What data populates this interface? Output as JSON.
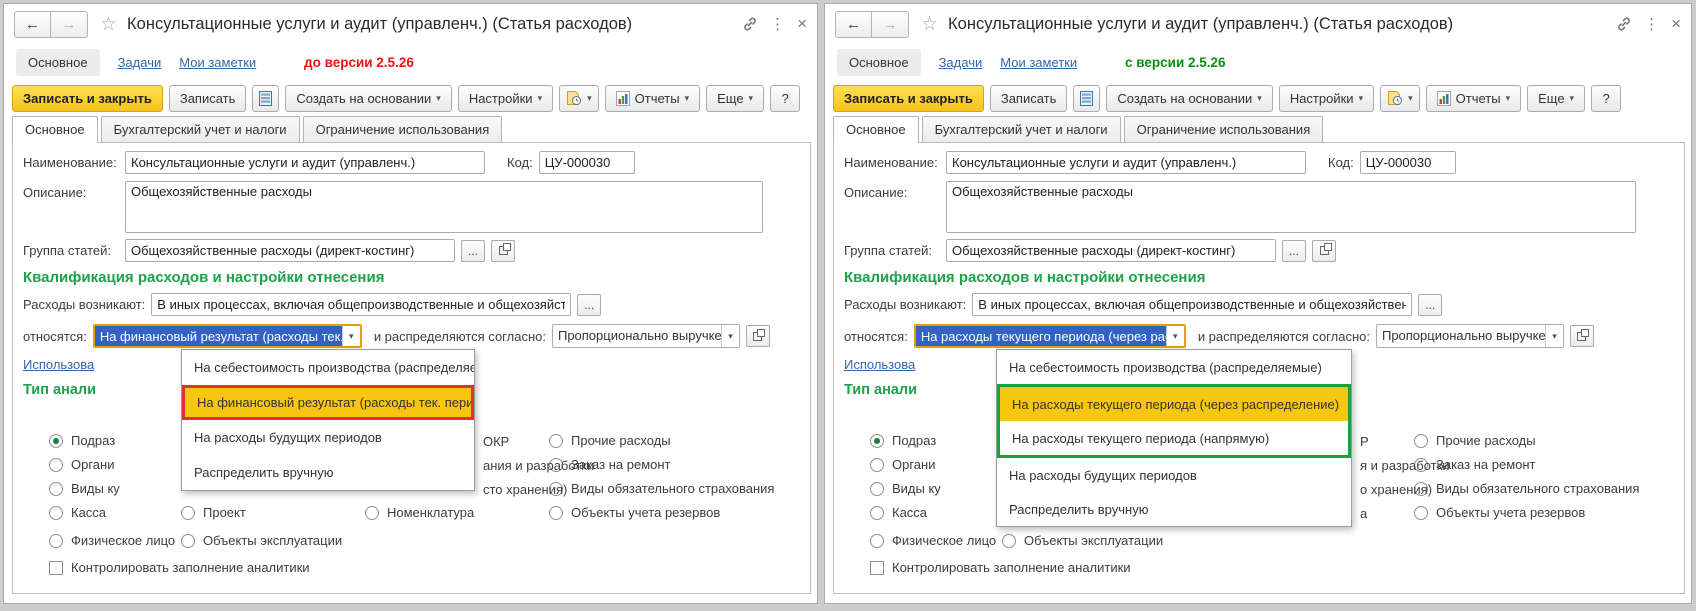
{
  "colors": {
    "title_underline": "#21a038",
    "before_frame": "#e0312e",
    "after_frame": "#1e9e3e",
    "dropdown_highlight": "#f6c611",
    "selection_blue": "#3163c5",
    "attention_border": "#dfa202",
    "section_green": "#1fa24a"
  },
  "windows": [
    {
      "title": "Консультационные услуги и аудит (управленч.)",
      "title_suffix": "(Статья расходов)",
      "version_note": "до версии 2.5.26",
      "nav": {
        "active": "Основное",
        "links": [
          "Задачи",
          "Мои заметки"
        ]
      },
      "toolbar": {
        "save_close": "Записать и закрыть",
        "save": "Записать",
        "create_based": "Создать на основании",
        "settings": "Настройки",
        "reports": "Отчеты",
        "more": "Еще",
        "help": "?"
      },
      "tabs": [
        "Основное",
        "Бухгалтерский учет и налоги",
        "Ограничение использования"
      ],
      "fields": {
        "name_label": "Наименование:",
        "name_value": "Консультационные услуги и аудит (управленч.)",
        "code_label": "Код:",
        "code_value": "ЦУ-000030",
        "desc_label": "Описание:",
        "desc_value": "Общехозяйственные расходы",
        "group_label": "Группа статей:",
        "group_value": "Общехозяйственные расходы (директ-костинг)",
        "section_header": "Квалификация расходов и настройки отнесения",
        "occur_label": "Расходы возникают:",
        "occur_value": "В иных процессах, включая общепроизводственные и общехозяйственные",
        "relate_label": "относятся:",
        "relate_value": "На финансовый результат (расходы тек. пе",
        "distribute_label": "и распределяются согласно:",
        "distribute_value": "Пропорционально выручке",
        "usage_link_fragment": "Использова",
        "analytics_header_fragment": "Тип анали",
        "ellipsis": "..."
      },
      "dropdown": {
        "items": [
          {
            "label": "На себестоимость производства (распределяемые)"
          },
          {
            "label": "На финансовый результат (расходы тек. периода)",
            "highlighted": true,
            "frame": "red"
          },
          {
            "label": "На расходы будущих периодов"
          },
          {
            "label": "Распределить вручную"
          }
        ]
      },
      "analytics": {
        "items": [
          {
            "label": "Подраз",
            "selected": true
          },
          {
            "label": "Органи"
          },
          {
            "label": "Виды ку"
          },
          {
            "label": "Касса"
          },
          {
            "label": "Физическое лицо"
          },
          {
            "label": "Проект"
          },
          {
            "label": "Объекты эксплуатации"
          },
          {
            "label": "Номенклатура"
          },
          {
            "label": "Прочие расходы"
          },
          {
            "label": "Заказ на ремонт"
          },
          {
            "label": "Виды обязательного страхования"
          },
          {
            "label": "Объекты учета резервов"
          }
        ],
        "fragments": [
          {
            "label": "ОКР"
          },
          {
            "label": "ания и разработки"
          },
          {
            "label": "сто хранения)"
          }
        ],
        "checkbox_label": "Контролировать заполнение аналитики"
      }
    },
    {
      "title": "Консультационные услуги и аудит (управленч.)",
      "title_suffix": "(Статья расходов)",
      "version_note": "с версии 2.5.26",
      "nav": {
        "active": "Основное",
        "links": [
          "Задачи",
          "Мои заметки"
        ]
      },
      "toolbar": {
        "save_close": "Записать и закрыть",
        "save": "Записать",
        "create_based": "Создать на основании",
        "settings": "Настройки",
        "reports": "Отчеты",
        "more": "Еще",
        "help": "?"
      },
      "tabs": [
        "Основное",
        "Бухгалтерский учет и налоги",
        "Ограничение использования"
      ],
      "fields": {
        "name_label": "Наименование:",
        "name_value": "Консультационные услуги и аудит (управленч.)",
        "code_label": "Код:",
        "code_value": "ЦУ-000030",
        "desc_label": "Описание:",
        "desc_value": "Общехозяйственные расходы",
        "group_label": "Группа статей:",
        "group_value": "Общехозяйственные расходы (директ-костинг)",
        "section_header": "Квалификация расходов и настройки отнесения",
        "occur_label": "Расходы возникают:",
        "occur_value": "В иных процессах, включая общепроизводственные и общехозяйственные",
        "relate_label": "относятся:",
        "relate_value": "На расходы текущего периода (через расп",
        "distribute_label": "и распределяются согласно:",
        "distribute_value": "Пропорционально выручке",
        "usage_link_fragment": "Использова",
        "analytics_header_fragment": "Тип анали",
        "ellipsis": "..."
      },
      "dropdown": {
        "items": [
          {
            "label": "На себестоимость производства (распределяемые)"
          },
          {
            "label": "На расходы текущего периода (через распределение)",
            "highlighted": true,
            "frame": "green"
          },
          {
            "label": "На расходы текущего периода (напрямую)",
            "frame": "green"
          },
          {
            "label": "На расходы будущих периодов"
          },
          {
            "label": "Распределить вручную"
          }
        ]
      },
      "analytics": {
        "items": [
          {
            "label": "Подраз",
            "selected": true
          },
          {
            "label": "Органи"
          },
          {
            "label": "Виды ку"
          },
          {
            "label": "Касса"
          },
          {
            "label": "Физическое лицо"
          },
          {
            "label": "Объекты эксплуатации"
          },
          {
            "label": "Прочие расходы"
          },
          {
            "label": "Заказ на ремонт"
          },
          {
            "label": "Виды обязательного страхования"
          },
          {
            "label": "Объекты учета резервов"
          }
        ],
        "fragments": [
          {
            "label": "Р"
          },
          {
            "label": "я и разработки"
          },
          {
            "label": "о хранения)"
          },
          {
            "label": "а"
          }
        ],
        "checkbox_label": "Контролировать заполнение аналитики"
      }
    }
  ]
}
